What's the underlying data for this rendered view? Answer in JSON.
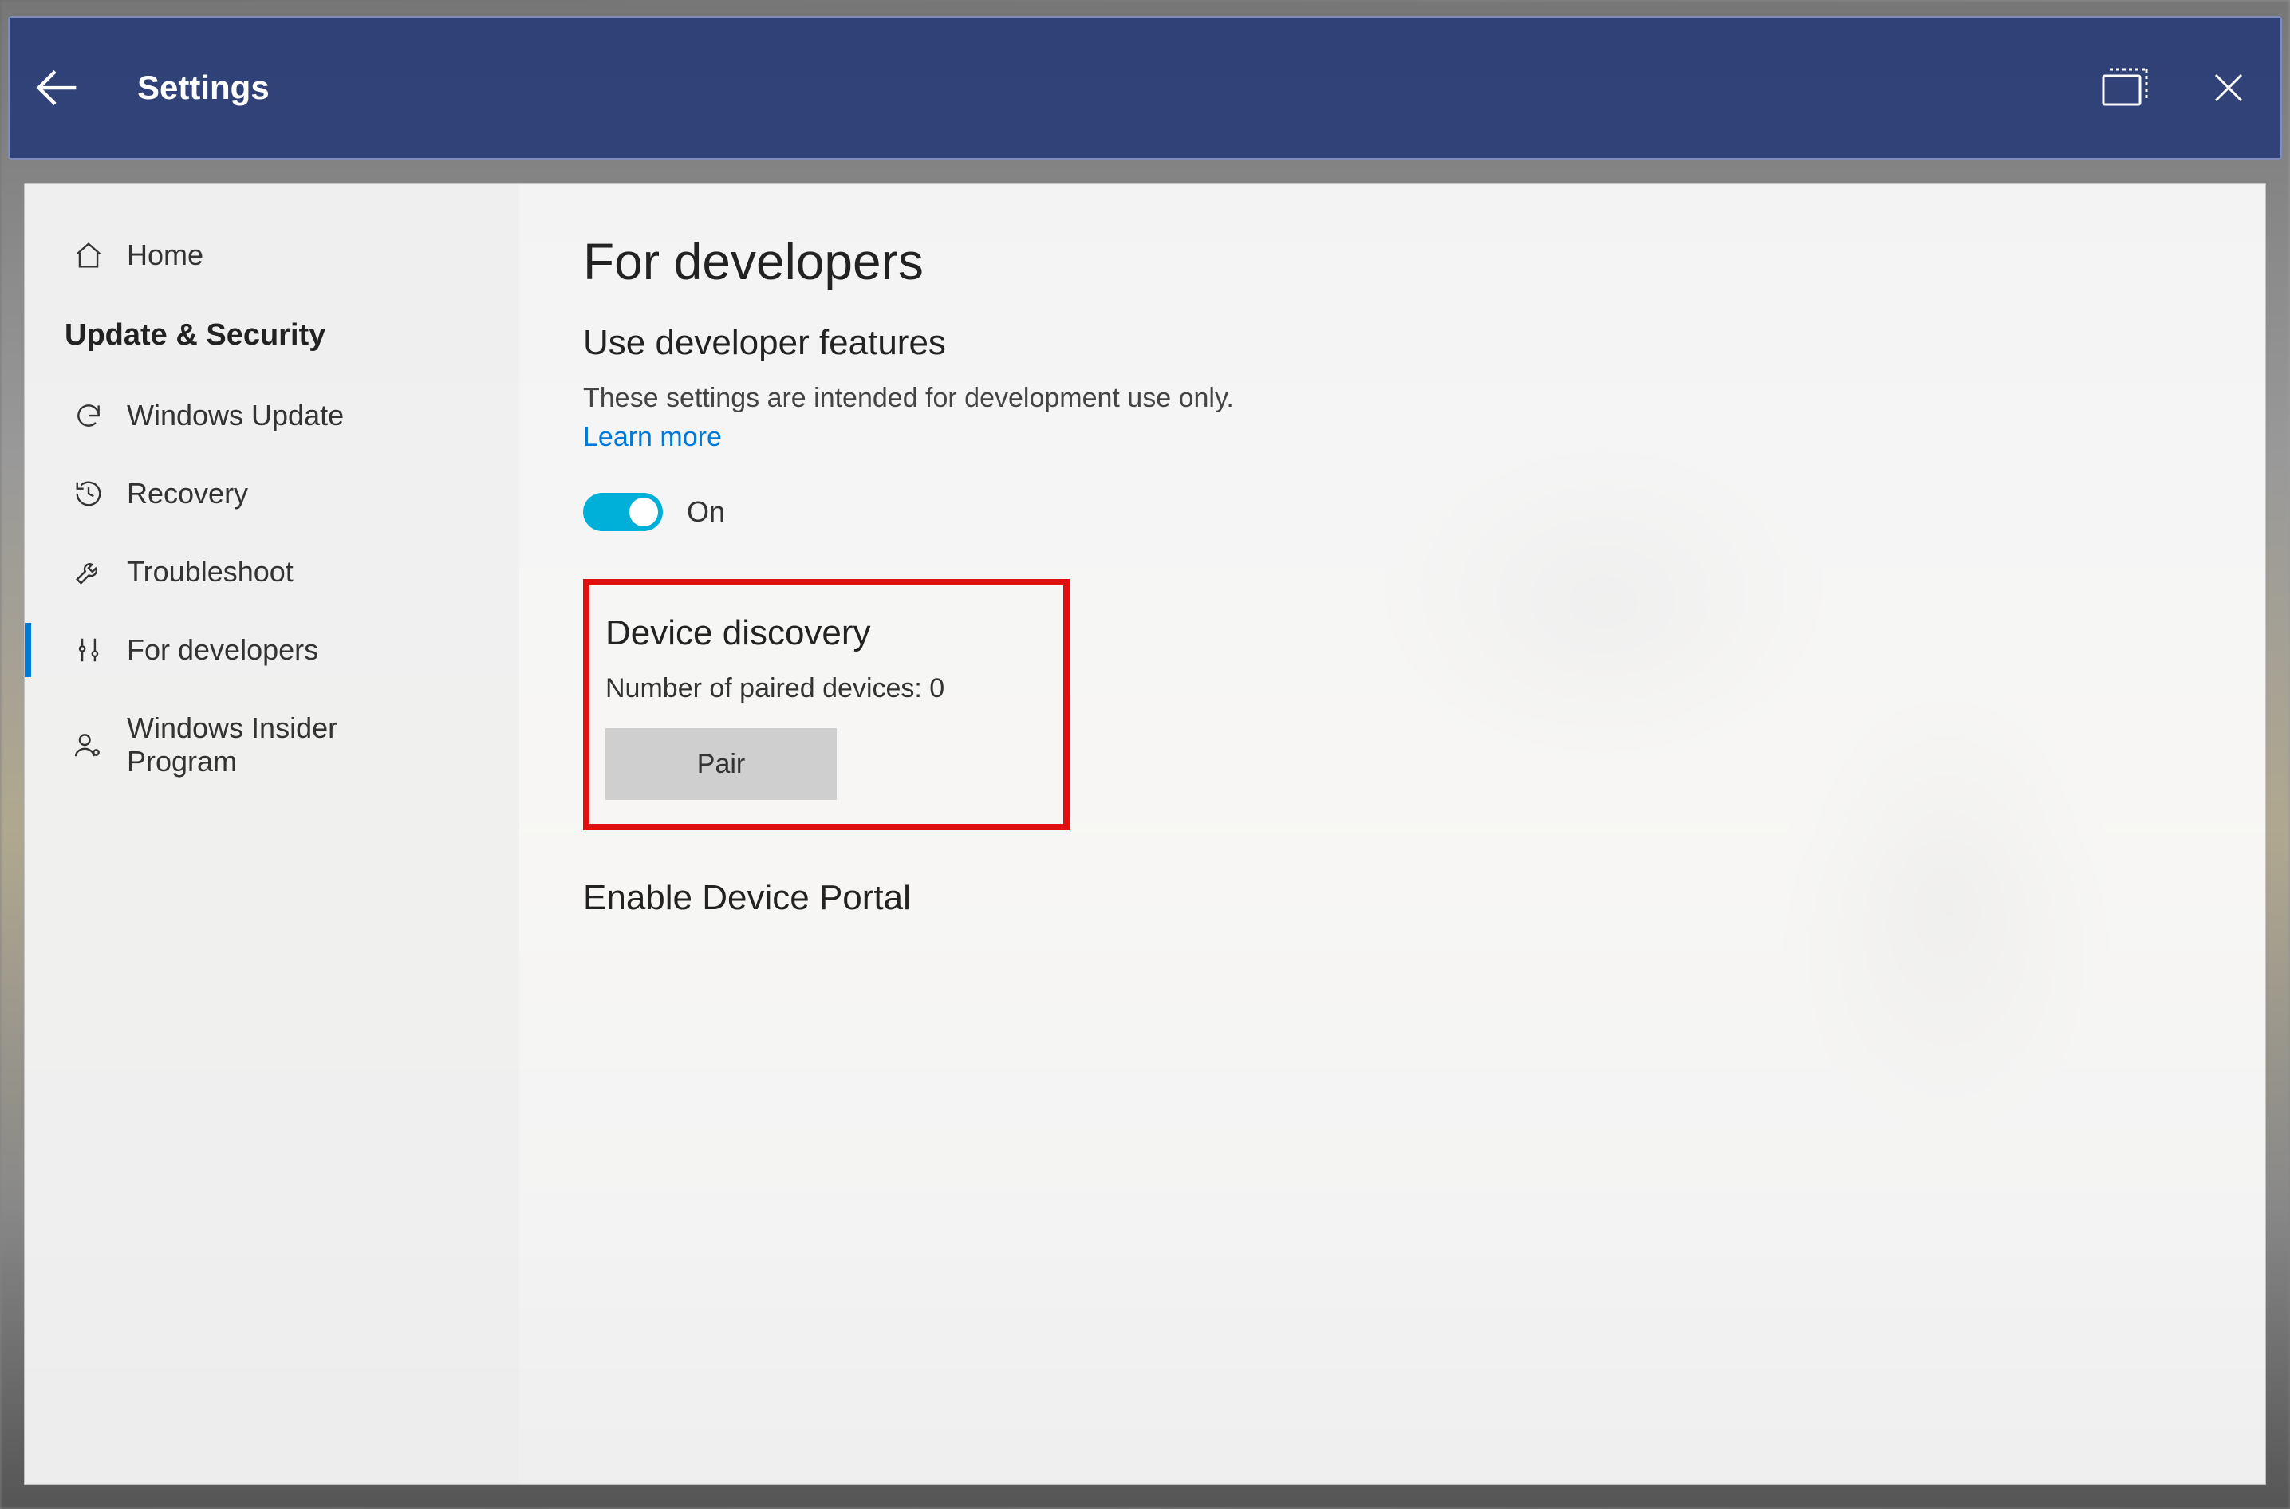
{
  "titlebar": {
    "title": "Settings"
  },
  "sidebar": {
    "home": "Home",
    "section": "Update & Security",
    "items": [
      {
        "label": "Windows Update"
      },
      {
        "label": "Recovery"
      },
      {
        "label": "Troubleshoot"
      },
      {
        "label": "For developers"
      },
      {
        "label": "Windows Insider Program"
      }
    ]
  },
  "content": {
    "page_title": "For developers",
    "dev_features_heading": "Use developer features",
    "dev_features_body": "These settings are intended for development use only.",
    "learn_more": "Learn more",
    "toggle_label": "On",
    "device_discovery_heading": "Device discovery",
    "paired_text": "Number of paired devices: 0",
    "pair_button": "Pair",
    "enable_portal_heading": "Enable Device Portal"
  }
}
